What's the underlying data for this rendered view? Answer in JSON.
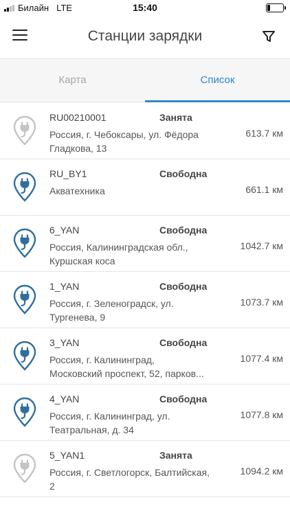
{
  "status_bar": {
    "carrier": "Билайн",
    "network": "LTE",
    "time": "15:40",
    "battery_level": 0.2
  },
  "header": {
    "title": "Станции зарядки",
    "menu_icon": "hamburger-menu-icon",
    "filter_icon": "filter-funnel-icon"
  },
  "tabs": [
    {
      "label": "Карта",
      "active": false
    },
    {
      "label": "Список",
      "active": true
    }
  ],
  "colors": {
    "accent": "#2f86cc",
    "pin_free": "#2f6f9f",
    "pin_busy": "#c4c4c4"
  },
  "stations": [
    {
      "name": "RU00210001",
      "status": "Занята",
      "available": false,
      "address": [
        "Россия, г. Чебоксары, ул. Фёдора",
        "Гладкова, 13"
      ],
      "distance": "613.7 км"
    },
    {
      "name": "RU_BY1",
      "status": "Свободна",
      "available": true,
      "address": [
        "Акватехника"
      ],
      "distance": "661.1 км"
    },
    {
      "name": "6_YAN",
      "status": "Свободна",
      "available": true,
      "address": [
        "Россия, Калининградская обл.,",
        "Куршская коса"
      ],
      "distance": "1042.7 км"
    },
    {
      "name": "1_YAN",
      "status": "Свободна",
      "available": true,
      "address": [
        "Россия, г. Зеленоградск, ул.",
        "Тургенева, 9"
      ],
      "distance": "1073.7 км"
    },
    {
      "name": "3_YAN",
      "status": "Свободна",
      "available": true,
      "address": [
        "Россия, г. Калининград,",
        "Московский проспект, 52, парков..."
      ],
      "distance": "1077.4 км"
    },
    {
      "name": "4_YAN",
      "status": "Свободна",
      "available": true,
      "address": [
        "Россия, г. Калининград, ул.",
        "Театральная, д. 34"
      ],
      "distance": "1077.8 км"
    },
    {
      "name": "5_YAN1",
      "status": "Занята",
      "available": false,
      "address": [
        "Россия, г. Светлогорск, Балтийская,",
        "2"
      ],
      "distance": "1094.2 км"
    }
  ]
}
